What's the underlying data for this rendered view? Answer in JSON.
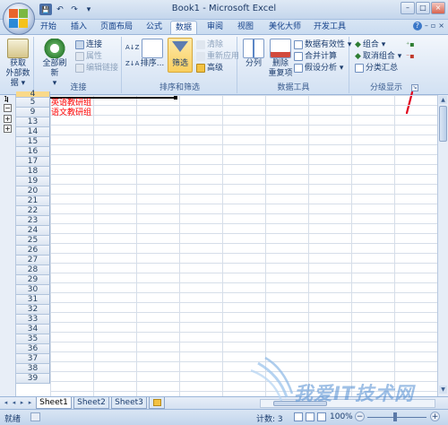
{
  "window": {
    "title": "Book1 - Microsoft Excel",
    "controls": {
      "minimize": "–",
      "maximize": "□",
      "close": "×"
    }
  },
  "qat": {
    "save": "💾",
    "undo": "↶",
    "redo": "↷",
    "customize": "▾"
  },
  "tabs": [
    {
      "label": "开始"
    },
    {
      "label": "插入"
    },
    {
      "label": "页面布局"
    },
    {
      "label": "公式"
    },
    {
      "label": "数据",
      "active": true
    },
    {
      "label": "审阅"
    },
    {
      "label": "视图"
    },
    {
      "label": "美化大师"
    },
    {
      "label": "开发工具"
    }
  ],
  "ribbon": {
    "get_external": {
      "line1": "获取",
      "line2": "外部数据 ▾"
    },
    "connections": {
      "refresh_all": {
        "line1": "全部刷新",
        "line2": "▾"
      },
      "connect": "连接",
      "properties": "属性",
      "edit_links": "编辑链接",
      "label": "连接"
    },
    "sort_filter": {
      "sort_az": "A↓Z",
      "sort_za": "Z↓A",
      "sort": "排序...",
      "filter": "筛选",
      "clear": "清除",
      "reapply": "重新应用",
      "advanced": "高级",
      "label": "排序和筛选"
    },
    "data_tools": {
      "text_to_columns": "分列",
      "remove_dup_1": "删除",
      "remove_dup_2": "重复项",
      "validation": "数据有效性 ▾",
      "consolidate": "合并计算",
      "what_if": "假设分析 ▾",
      "label": "数据工具"
    },
    "outline": {
      "group": "组合 ▾",
      "ungroup": "取消组合 ▾",
      "subtotal": "分类汇总",
      "label": "分级显示",
      "launcher": "↘"
    }
  },
  "outline_bar": {
    "level1": "1",
    "minus": "−",
    "plus": "+"
  },
  "rows": [
    {
      "num": "4"
    },
    {
      "num": "5"
    },
    {
      "num": "9"
    },
    {
      "num": "13"
    },
    {
      "num": "14"
    },
    {
      "num": "15"
    },
    {
      "num": "16"
    },
    {
      "num": "17"
    },
    {
      "num": "18"
    },
    {
      "num": "19"
    },
    {
      "num": "20"
    },
    {
      "num": "21"
    },
    {
      "num": "22"
    },
    {
      "num": "23"
    },
    {
      "num": "24"
    },
    {
      "num": "25"
    },
    {
      "num": "26"
    },
    {
      "num": "27"
    },
    {
      "num": "28"
    },
    {
      "num": "29"
    },
    {
      "num": "30"
    },
    {
      "num": "31"
    },
    {
      "num": "32"
    },
    {
      "num": "33"
    },
    {
      "num": "34"
    },
    {
      "num": "35"
    },
    {
      "num": "36"
    },
    {
      "num": "37"
    },
    {
      "num": "38"
    },
    {
      "num": "39"
    }
  ],
  "cells": {
    "r5": "英语教研组",
    "r9": "语文教研组"
  },
  "sheets": [
    {
      "label": "Sheet1",
      "active": true
    },
    {
      "label": "Sheet2"
    },
    {
      "label": "Sheet3"
    }
  ],
  "status": {
    "ready": "就绪",
    "count": "计数: 3",
    "zoom": "100%",
    "zoom_minus": "−",
    "zoom_plus": "+"
  },
  "watermark": {
    "text": "我爱IT技术网"
  },
  "colors": {
    "accent_red": "#ff0000",
    "ribbon_blue": "#15428b",
    "filter_active": "#fbd36a"
  }
}
